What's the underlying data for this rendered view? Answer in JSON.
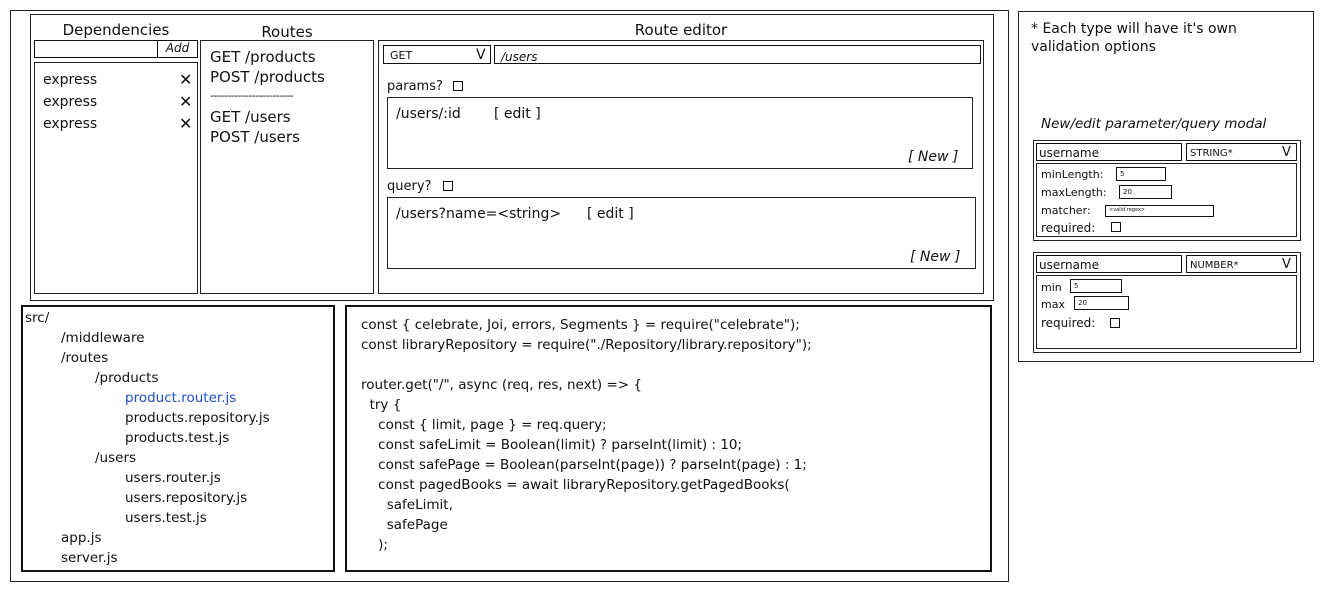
{
  "dependencies": {
    "title": "Dependencies",
    "input_value": "",
    "add_label": "Add",
    "items": [
      {
        "name": "express",
        "remove": "✕"
      },
      {
        "name": "express",
        "remove": "✕"
      },
      {
        "name": "express",
        "remove": "✕"
      }
    ]
  },
  "routes": {
    "title": "Routes",
    "items": [
      "GET /products",
      "POST /products",
      "GET /users",
      "POST /users"
    ],
    "divider": "------------------------"
  },
  "route_editor": {
    "title": "Route editor",
    "method": "GET",
    "method_arrow": "V",
    "path": "/users",
    "params_label": "params?",
    "params_entry": "/users/:id",
    "params_edit": "[ edit ]",
    "params_new": "[ New ]",
    "query_label": "query?",
    "query_entry": "/users?name=<string>",
    "query_edit": "[ edit ]",
    "query_new": "[ New ]"
  },
  "file_tree": {
    "lines": [
      {
        "text": "src/",
        "indent": 0,
        "highlight": false
      },
      {
        "text": "/middleware",
        "indent": 1,
        "highlight": false
      },
      {
        "text": "/routes",
        "indent": 1,
        "highlight": false
      },
      {
        "text": "/products",
        "indent": 2,
        "highlight": false
      },
      {
        "text": "product.router.js",
        "indent": 3,
        "highlight": true
      },
      {
        "text": "products.repository.js",
        "indent": 3,
        "highlight": false
      },
      {
        "text": "products.test.js",
        "indent": 3,
        "highlight": false
      },
      {
        "text": "/users",
        "indent": 2,
        "highlight": false
      },
      {
        "text": "users.router.js",
        "indent": 3,
        "highlight": false
      },
      {
        "text": "users.repository.js",
        "indent": 3,
        "highlight": false
      },
      {
        "text": "users.test.js",
        "indent": 3,
        "highlight": false
      },
      {
        "text": "app.js",
        "indent": 1,
        "highlight": false
      },
      {
        "text": "server.js",
        "indent": 1,
        "highlight": false
      }
    ],
    "highlight_color": "#1f4fd1"
  },
  "code": {
    "lines": [
      "const { celebrate, Joi, errors, Segments } = require(\"celebrate\");",
      "const libraryRepository = require(\"./Repository/library.repository\");",
      "",
      "router.get(\"/\", async (req, res, next) => {",
      "  try {",
      "    const { limit, page } = req.query;",
      "    const safeLimit = Boolean(limit) ? parseInt(limit) : 10;",
      "    const safePage = Boolean(parseInt(page)) ? parseInt(page) : 1;",
      "    const pagedBooks = await libraryRepository.getPagedBooks(",
      "      safeLimit,",
      "      safePage",
      "    );"
    ]
  },
  "notes": {
    "note": "* Each type will have it's own\nvalidation options",
    "modal_title": "New/edit parameter/query modal",
    "modal1": {
      "name": "username",
      "type": "STRING*",
      "arrow": "V",
      "min_length_label": "minLength:",
      "min_length_value": "5",
      "max_length_label": "maxLength:",
      "max_length_value": "20",
      "matcher_label": "matcher:",
      "matcher_value": "<valid regex>",
      "required_label": "required:"
    },
    "modal2": {
      "name": "username",
      "type": "NUMBER*",
      "arrow": "V",
      "min_label": "min",
      "min_value": "5",
      "max_label": "max",
      "max_value": "20",
      "required_label": "required:"
    }
  }
}
